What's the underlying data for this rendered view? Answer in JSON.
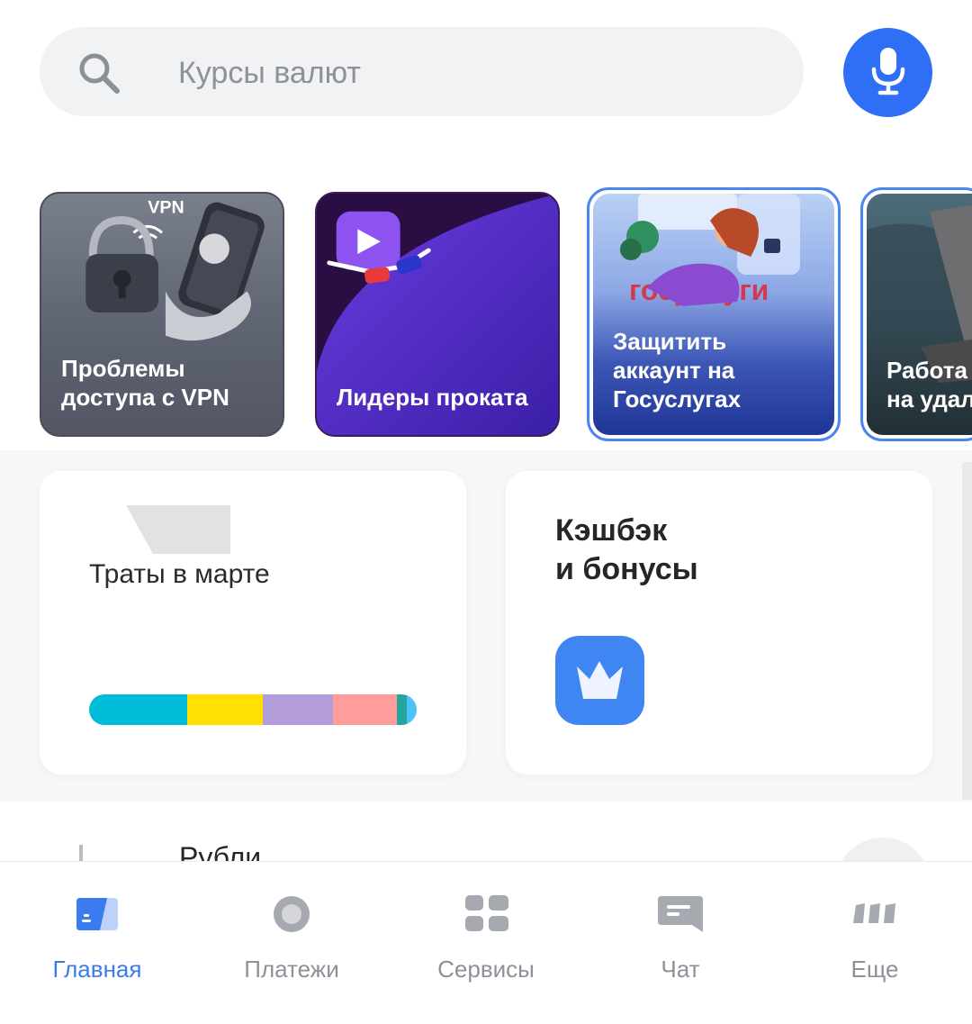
{
  "search": {
    "placeholder": "Курсы валют"
  },
  "stories": [
    {
      "label": "Проблемы\nдоступа с VPN",
      "badge": "VPN"
    },
    {
      "label": "Лидеры проката"
    },
    {
      "label": "Защитить\nаккаунт на\nГосуслугах",
      "art_text": "госуслуги"
    },
    {
      "label": "Работа\nна удал"
    }
  ],
  "widgets": {
    "spending": {
      "title": "Траты в марте",
      "segments": [
        {
          "color": "#00bcd9",
          "share": 0.3
        },
        {
          "color": "#ffe000",
          "share": 0.23
        },
        {
          "color": "#b39ddb",
          "share": 0.215
        },
        {
          "color": "#ff9c9c",
          "share": 0.195
        },
        {
          "color": "#26a69a",
          "share": 0.03
        },
        {
          "color": "#4fc3f7",
          "share": 0.03
        }
      ]
    },
    "cashback": {
      "title": "Кэшбэк\nи бонусы",
      "icon": "crown-icon"
    }
  },
  "accounts": {
    "title": "Рубли"
  },
  "nav": [
    {
      "label": "Главная",
      "icon": "home-card-icon",
      "active": true
    },
    {
      "label": "Платежи",
      "icon": "payments-circle-icon",
      "active": false
    },
    {
      "label": "Сервисы",
      "icon": "services-grid-icon",
      "active": false
    },
    {
      "label": "Чат",
      "icon": "chat-icon",
      "active": false
    },
    {
      "label": "Еще",
      "icon": "more-icon",
      "active": false
    }
  ],
  "colors": {
    "accent": "#2f6ff6",
    "nav_active": "#3a7bf0",
    "nav_inactive": "#8e9198",
    "cashback_icon": "#3f86f3"
  }
}
